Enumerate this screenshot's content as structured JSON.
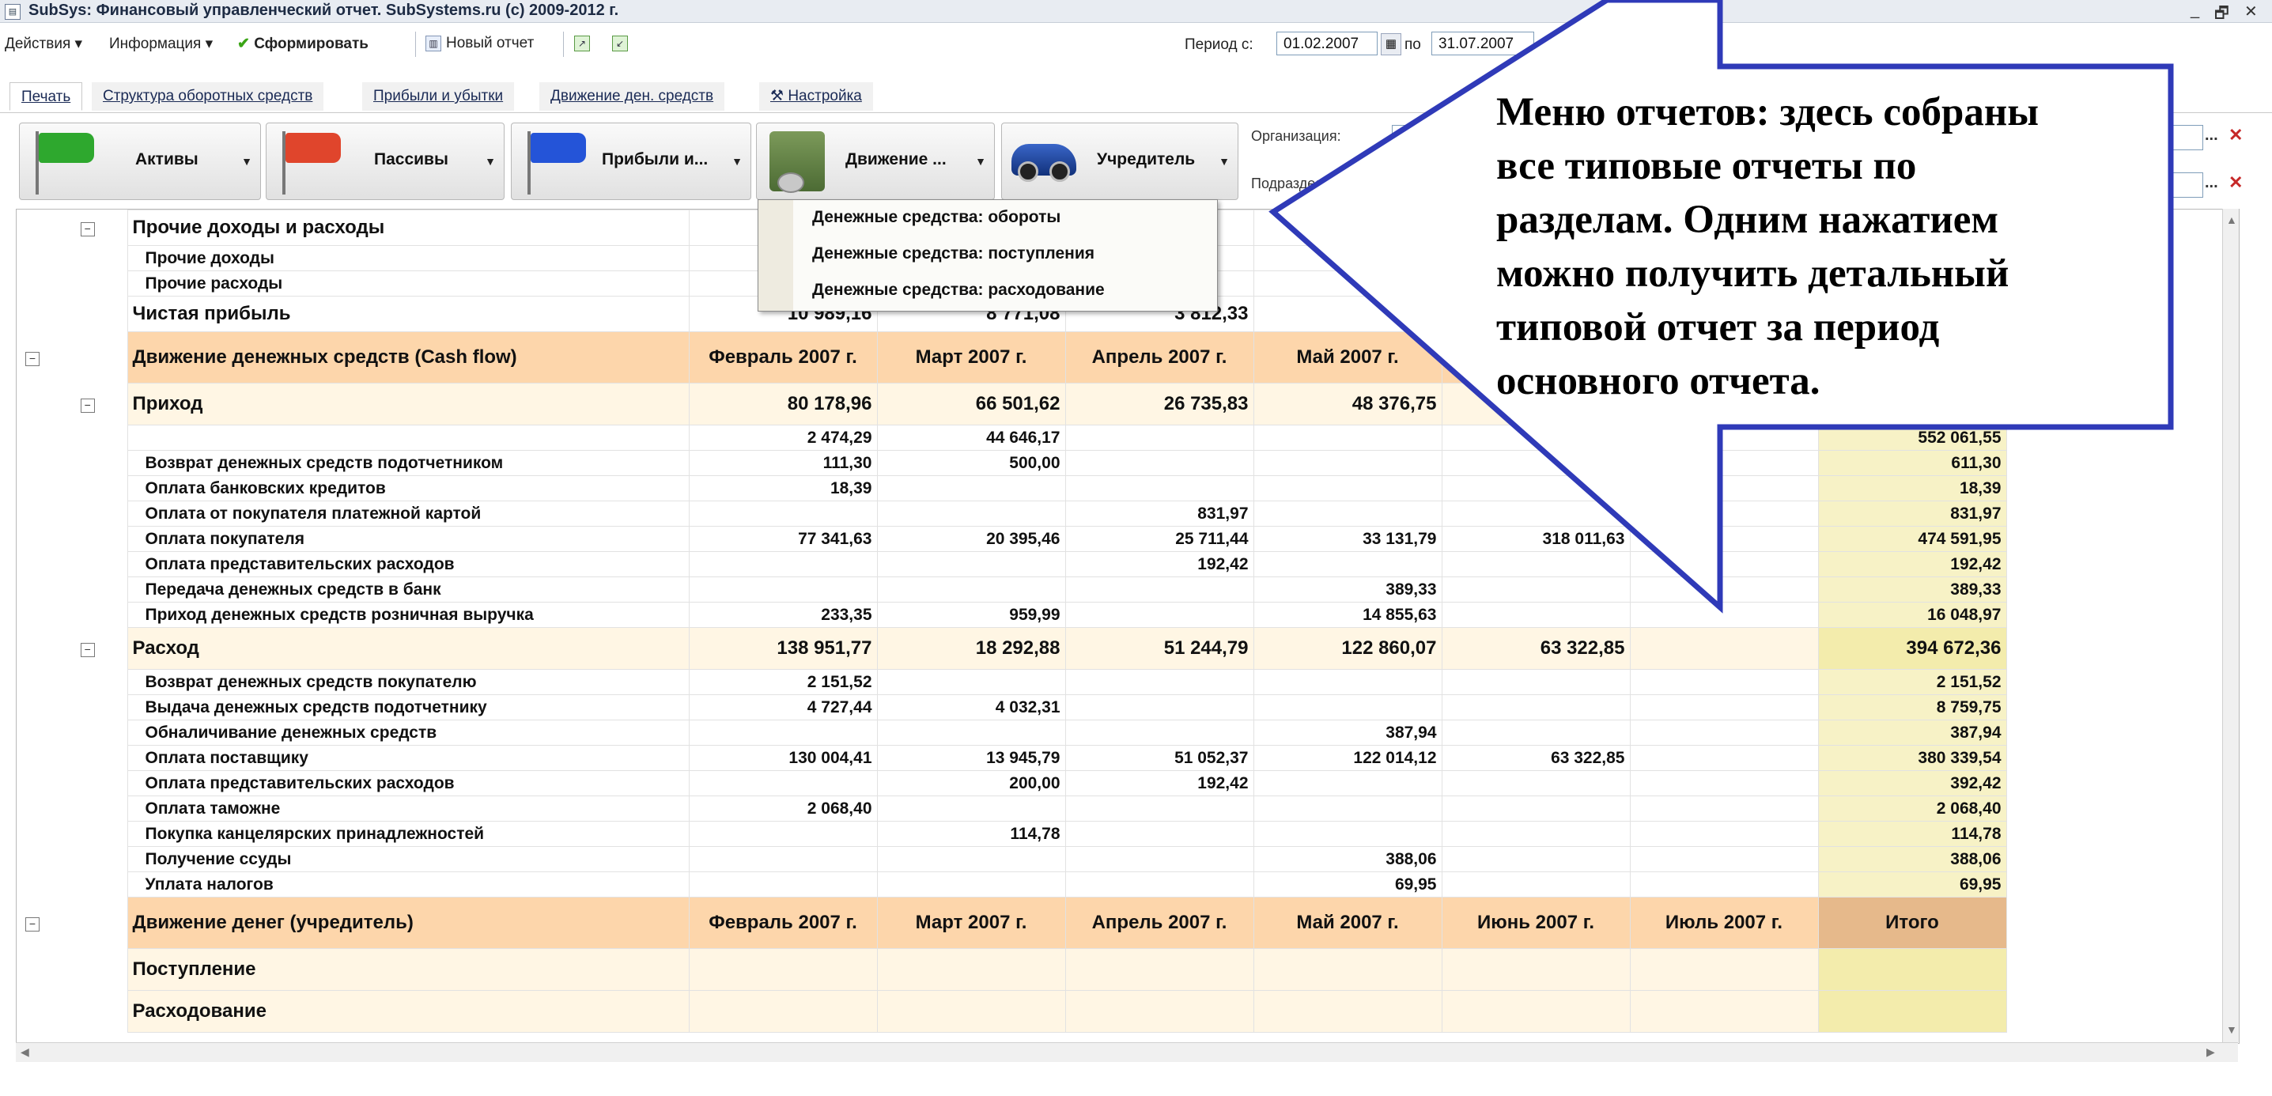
{
  "window": {
    "title": "SubSys: Финансовый управленческий отчет. SubSystems.ru (c) 2009-2012 г.",
    "controls": [
      "_",
      "🗗",
      "✕"
    ]
  },
  "toolbar": {
    "actions": "Действия ▾",
    "info": "Информация ▾",
    "generate": "Сформировать",
    "new_report": "Новый отчет",
    "period_from_label": "Период с:",
    "period_from": "01.02.2007",
    "period_to_label": "по",
    "period_to": "31.07.2007"
  },
  "tabs": [
    {
      "label": "Печать"
    },
    {
      "label": "Структура оборотных средств"
    },
    {
      "label": "Прибыли и убытки"
    },
    {
      "label": "Движение ден. средств"
    },
    {
      "label": "Настройка"
    }
  ],
  "report_buttons": [
    {
      "label": "Активы",
      "color": "#2ea82e"
    },
    {
      "label": "Пассивы",
      "color": "#e0452c"
    },
    {
      "label": "Прибыли и...",
      "color": "#2454d8"
    },
    {
      "label": "Движение ...",
      "color": "#6b8a4a"
    },
    {
      "label": "Учредитель",
      "color": "#1e46b0"
    }
  ],
  "side": {
    "org_label": "Организация:",
    "dept_label": "Подразделе",
    "dots": "...",
    "clear": "✕"
  },
  "dropdown": {
    "items": [
      "Денежные средства: обороты",
      "Денежные средства: поступления",
      "Денежные средства: расходование"
    ]
  },
  "callout": {
    "lines": [
      "Меню отчетов: здесь собраны",
      "все типовые отчеты по",
      "разделам. Одним нажатием",
      "можно получить детальный",
      "типовой отчет за период",
      "основного отчета."
    ]
  },
  "table": {
    "rows": [
      {
        "type": "bold",
        "tree": "box",
        "label": "Прочие доходы и расходы",
        "cells": [
          "",
          "",
          "",
          "",
          "",
          "",
          ""
        ]
      },
      {
        "type": "item",
        "tree": "line",
        "label": "Прочие доходы",
        "cells": [
          "",
          "",
          "",
          "",
          "",
          "",
          ""
        ]
      },
      {
        "type": "item",
        "tree": "line",
        "label": "Прочие расходы",
        "cells": [
          "",
          "",
          "",
          "",
          "",
          "",
          ""
        ]
      },
      {
        "type": "bold",
        "tree": "none",
        "label": "Чистая прибыль",
        "cells": [
          "10 989,16",
          "8 771,08",
          "3 812,33",
          "19...",
          "",
          "",
          ""
        ]
      },
      {
        "type": "sec",
        "tree": "box",
        "label": "Движение денежных средств (Cash flow)",
        "cells": [
          "Февраль 2007 г.",
          "Март 2007 г.",
          "Апрель 2007 г.",
          "Май 2007 г.",
          "",
          "",
          ""
        ]
      },
      {
        "type": "grp",
        "tree": "box",
        "label": "Приход",
        "cells": [
          "80 178,96",
          "66 501,62",
          "26 735,83",
          "48 376,75",
          "",
          "",
          ""
        ]
      },
      {
        "type": "item",
        "tree": "line",
        "label": "",
        "cells": [
          "2 474,29",
          "44 646,17",
          "",
          "",
          "",
          "",
          "552 061,55"
        ]
      },
      {
        "type": "item",
        "tree": "line",
        "label": "Возврат денежных средств подотчетником",
        "cells": [
          "111,30",
          "500,00",
          "",
          "",
          "",
          "",
          "611,30"
        ]
      },
      {
        "type": "item",
        "tree": "line",
        "label": "Оплата банковских кредитов",
        "cells": [
          "18,39",
          "",
          "",
          "",
          "",
          "",
          "18,39"
        ]
      },
      {
        "type": "item",
        "tree": "line",
        "label": "Оплата от покупателя платежной картой",
        "cells": [
          "",
          "",
          "831,97",
          "",
          "",
          "",
          "831,97"
        ]
      },
      {
        "type": "item",
        "tree": "line",
        "label": "Оплата покупателя",
        "cells": [
          "77 341,63",
          "20 395,46",
          "25 711,44",
          "33 131,79",
          "318 011,63",
          "",
          "474 591,95"
        ]
      },
      {
        "type": "item",
        "tree": "line",
        "label": "Оплата представительских расходов",
        "cells": [
          "",
          "",
          "192,42",
          "",
          "",
          "",
          "192,42"
        ]
      },
      {
        "type": "item",
        "tree": "line",
        "label": "Передача денежных средств в банк",
        "cells": [
          "",
          "",
          "",
          "389,33",
          "",
          "",
          "389,33"
        ]
      },
      {
        "type": "item",
        "tree": "line",
        "label": "Приход денежных средств розничная выручка",
        "cells": [
          "233,35",
          "959,99",
          "",
          "14 855,63",
          "",
          "",
          "16 048,97"
        ]
      },
      {
        "type": "grp",
        "tree": "box",
        "label": "Расход",
        "cells": [
          "138 951,77",
          "18 292,88",
          "51 244,79",
          "122 860,07",
          "63 322,85",
          "",
          "394 672,36"
        ]
      },
      {
        "type": "item",
        "tree": "line",
        "label": "Возврат денежных средств покупателю",
        "cells": [
          "2 151,52",
          "",
          "",
          "",
          "",
          "",
          "2 151,52"
        ]
      },
      {
        "type": "item",
        "tree": "line",
        "label": "Выдача денежных средств подотчетнику",
        "cells": [
          "4 727,44",
          "4 032,31",
          "",
          "",
          "",
          "",
          "8 759,75"
        ]
      },
      {
        "type": "item",
        "tree": "line",
        "label": "Обналичивание денежных средств",
        "cells": [
          "",
          "",
          "",
          "387,94",
          "",
          "",
          "387,94"
        ]
      },
      {
        "type": "item",
        "tree": "line",
        "label": "Оплата поставщику",
        "cells": [
          "130 004,41",
          "13 945,79",
          "51 052,37",
          "122 014,12",
          "63 322,85",
          "",
          "380 339,54"
        ]
      },
      {
        "type": "item",
        "tree": "line",
        "label": "Оплата представительских расходов",
        "cells": [
          "",
          "200,00",
          "192,42",
          "",
          "",
          "",
          "392,42"
        ]
      },
      {
        "type": "item",
        "tree": "line",
        "label": "Оплата таможне",
        "cells": [
          "2 068,40",
          "",
          "",
          "",
          "",
          "",
          "2 068,40"
        ]
      },
      {
        "type": "item",
        "tree": "line",
        "label": "Покупка канцелярских принадлежностей",
        "cells": [
          "",
          "114,78",
          "",
          "",
          "",
          "",
          "114,78"
        ]
      },
      {
        "type": "item",
        "tree": "line",
        "label": "Получение ссуды",
        "cells": [
          "",
          "",
          "",
          "388,06",
          "",
          "",
          "388,06"
        ]
      },
      {
        "type": "item",
        "tree": "line",
        "label": "Уплата налогов",
        "cells": [
          "",
          "",
          "",
          "69,95",
          "",
          "",
          "69,95"
        ]
      },
      {
        "type": "sec",
        "tree": "box",
        "label": "Движение денег (учредитель)",
        "cells": [
          "Февраль 2007 г.",
          "Март 2007 г.",
          "Апрель 2007 г.",
          "Май 2007 г.",
          "Июнь 2007 г.",
          "Июль 2007 г.",
          "Итого"
        ]
      },
      {
        "type": "grp2",
        "tree": "none",
        "label": "Поступление",
        "cells": [
          "",
          "",
          "",
          "",
          "",
          "",
          ""
        ]
      },
      {
        "type": "grp2",
        "tree": "none",
        "label": "Расходование",
        "cells": [
          "",
          "",
          "",
          "",
          "",
          "",
          ""
        ]
      }
    ]
  }
}
